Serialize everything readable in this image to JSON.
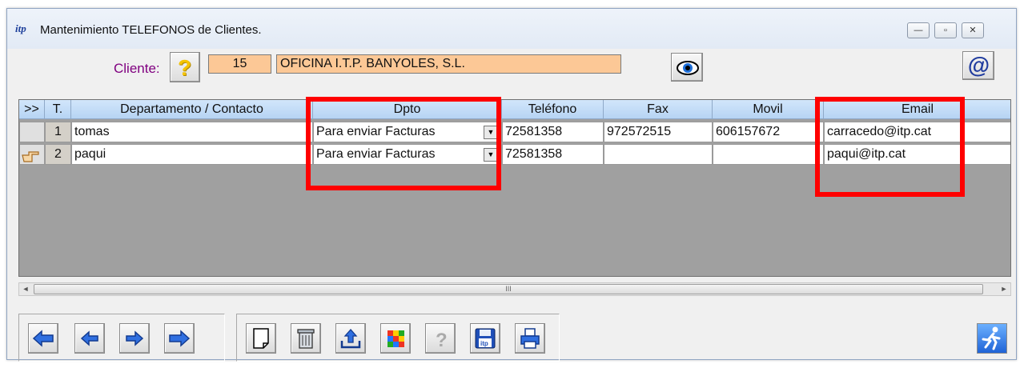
{
  "window": {
    "title": "Mantenimiento TELEFONOS de Clientes.",
    "app_icon_text": "itp",
    "controls": [
      "minimize-icon",
      "maximize-icon",
      "close-icon"
    ],
    "min_glyph": "—",
    "max_glyph": "▫",
    "close_glyph": "✕"
  },
  "cliente": {
    "label": "Cliente:",
    "help_glyph": "?",
    "code": "15",
    "name": "OFICINA I.T.P. BANYOLES, S.L."
  },
  "at_glyph": "@",
  "grid": {
    "columns": [
      ">>",
      "T.",
      "Departamento / Contacto",
      "Dpto",
      "Teléfono",
      "Fax",
      "Movil",
      "Email"
    ],
    "rows": [
      {
        "t": "1",
        "contacto": "tomas",
        "dpto": "Para enviar Facturas",
        "telefono": "72581358",
        "fax": "972572515",
        "movil": "606157672",
        "email": "carracedo@itp.cat"
      },
      {
        "t": "2",
        "contacto": "paqui",
        "dpto": "Para enviar Facturas",
        "telefono": "72581358",
        "fax": "",
        "movil": "",
        "email": "paqui@itp.cat"
      }
    ],
    "dropdown_glyph": "▼",
    "scroll_thumb_text": "III",
    "scroll_left": "◄",
    "scroll_right": "►"
  },
  "colors": {
    "field_bg": "#fcc896",
    "cliente_label": "#800080",
    "highlight_box": "#ff0000",
    "header_bg": "#c4ddf7",
    "grid_bg": "#a0a0a0"
  }
}
